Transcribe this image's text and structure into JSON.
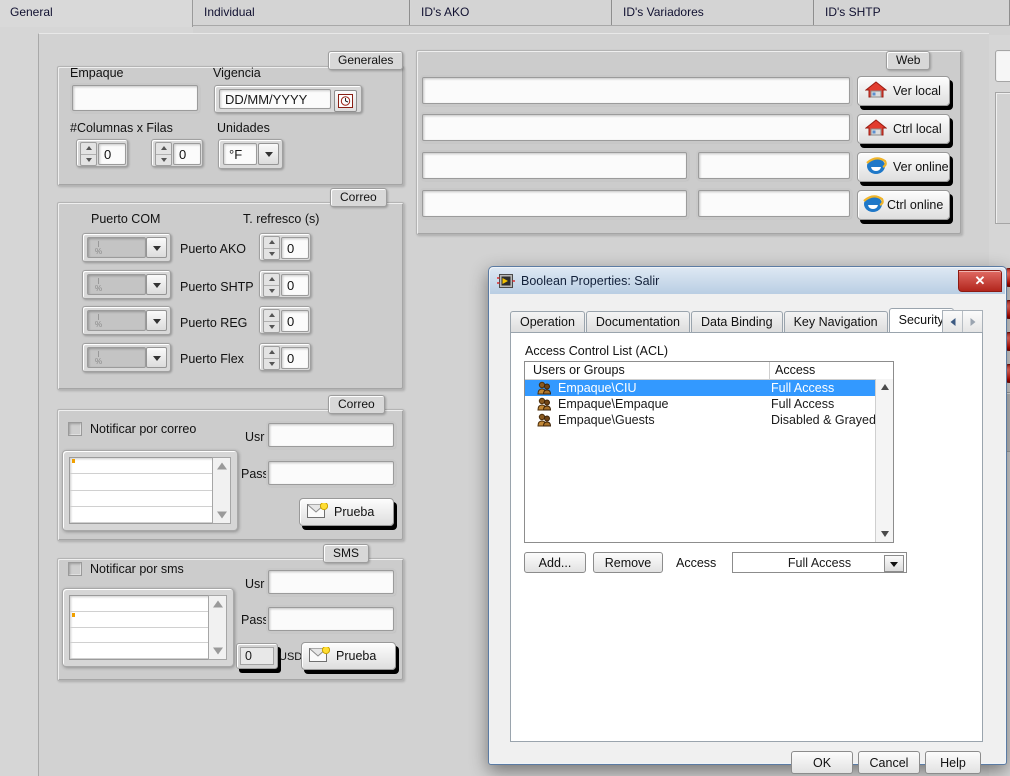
{
  "app": {
    "tabs": [
      {
        "label": "General",
        "active": true
      },
      {
        "label": "Individual",
        "active": false
      },
      {
        "label": "ID's AKO",
        "active": false
      },
      {
        "label": "ID's Variadores",
        "active": false
      },
      {
        "label": "ID's SHTP",
        "active": false
      }
    ]
  },
  "generales": {
    "title": "Generales",
    "empaque_label": "Empaque",
    "empaque_value": "",
    "vigencia_label": "Vigencia",
    "vigencia_value": "DD/MM/YYYY",
    "columnas_label": "#Columnas  x  Filas",
    "columnas_value": "0",
    "filas_value": "0",
    "unidades_label": "Unidades",
    "unidades_value": "°F"
  },
  "puertos": {
    "title": "Correo",
    "col_port": "Puerto COM",
    "col_refresh": "T. refresco (s)",
    "rows": [
      {
        "port_value": "",
        "name": "Puerto AKO",
        "refresh": "0"
      },
      {
        "port_value": "",
        "name": "Puerto SHTP",
        "refresh": "0"
      },
      {
        "port_value": "",
        "name": "Puerto REG",
        "refresh": "0"
      },
      {
        "port_value": "",
        "name": "Puerto Flex",
        "refresh": "0"
      }
    ]
  },
  "correo": {
    "title": "Correo",
    "notify_label": "Notificar por correo",
    "notify_checked": false,
    "usr_label": "Usr",
    "usr_value": "",
    "pass_label": "Pass",
    "pass_value": "",
    "test_label": "Prueba"
  },
  "sms": {
    "title": "SMS",
    "notify_label": "Notificar por sms",
    "notify_checked": false,
    "usr_label": "Usr",
    "usr_value": "",
    "pass_label": "Pass",
    "pass_value": "",
    "amount_value": "0",
    "amount_unit": "USD",
    "test_label": "Prueba"
  },
  "web": {
    "title": "Web",
    "field_local_view": "",
    "field_local_ctrl": "",
    "field_online_view_a": "",
    "field_online_view_b": "",
    "field_online_ctrl_a": "",
    "field_online_ctrl_b": "",
    "buttons": [
      {
        "label": "Ver local",
        "icon": "house-icon"
      },
      {
        "label": "Ctrl  local",
        "icon": "house-icon"
      },
      {
        "label": "Ver online",
        "icon": "internet-explorer-icon"
      },
      {
        "label": "Ctrl  online",
        "icon": "internet-explorer-icon"
      }
    ]
  },
  "dialog": {
    "title": "Boolean Properties: Salir",
    "close_label": "✕",
    "tabs": [
      {
        "label": "Operation",
        "active": false
      },
      {
        "label": "Documentation",
        "active": false
      },
      {
        "label": "Data Binding",
        "active": false
      },
      {
        "label": "Key Navigation",
        "active": false
      },
      {
        "label": "Security",
        "active": true
      }
    ],
    "acl_caption": "Access Control List (ACL)",
    "acl_headers": {
      "users": "Users or Groups",
      "access": "Access"
    },
    "acl_rows": [
      {
        "name": "Empaque\\CIU",
        "access": "Full Access",
        "selected": true
      },
      {
        "name": "Empaque\\Empaque",
        "access": "Full Access",
        "selected": false
      },
      {
        "name": "Empaque\\Guests",
        "access": "Disabled & Grayed O",
        "selected": false
      }
    ],
    "add_label": "Add...",
    "remove_label": "Remove",
    "access_label": "Access",
    "access_value": "Full Access",
    "ok_label": "OK",
    "cancel_label": "Cancel",
    "help_label": "Help"
  },
  "colors": {
    "selection_blue": "#3399ff",
    "led_red": "#c00a00",
    "dialog_title": "#b9cee3",
    "panel_gray": "#d2d2d2"
  }
}
